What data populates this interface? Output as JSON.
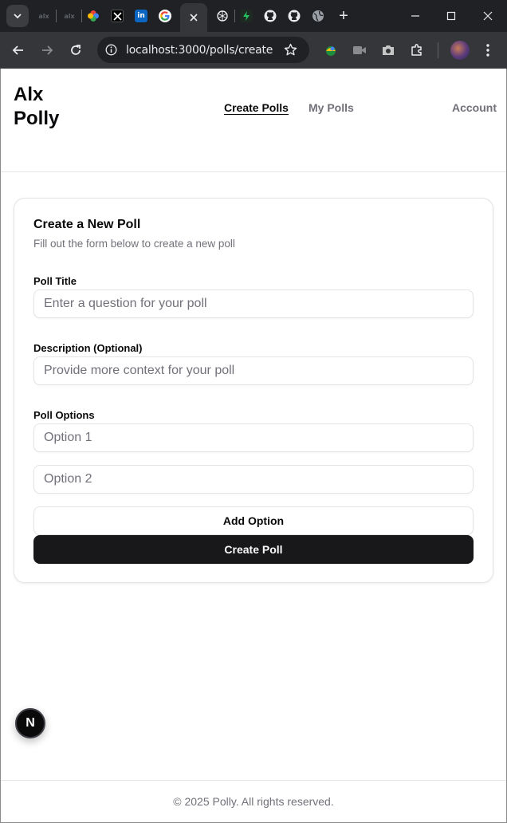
{
  "browser": {
    "url": "localhost:3000/polls/create",
    "tabs": [
      {
        "icon": "alx-icon"
      },
      {
        "icon": "alx-icon"
      },
      {
        "icon": "pinwheel-icon"
      },
      {
        "icon": "x-logo-icon"
      },
      {
        "icon": "linkedin-icon"
      },
      {
        "icon": "google-icon"
      },
      {
        "icon": "close-icon",
        "active": true
      },
      {
        "icon": "openai-icon"
      },
      {
        "icon": "bolt-icon"
      },
      {
        "icon": "github-icon"
      },
      {
        "icon": "github-icon"
      },
      {
        "icon": "globe-icon"
      }
    ],
    "new_tab_label": "+"
  },
  "header": {
    "logo": "Alx Polly",
    "nav": {
      "create": "Create Polls",
      "my_polls": "My Polls",
      "account": "Account"
    }
  },
  "form": {
    "title": "Create a New Poll",
    "description": "Fill out the form below to create a new poll",
    "poll_title_label": "Poll Title",
    "poll_title_placeholder": "Enter a question for your poll",
    "description_label": "Description (Optional)",
    "description_placeholder": "Provide more context for your poll",
    "options_label": "Poll Options",
    "option1_placeholder": "Option 1",
    "option2_placeholder": "Option 2",
    "add_option_label": "Add Option",
    "submit_label": "Create Poll"
  },
  "footer": {
    "text": "© 2025 Polly. All rights reserved."
  },
  "dev_badge": "N",
  "colors": {
    "primary": "#18181b",
    "muted": "#71717a",
    "border": "#e4e4e7",
    "chrome_dark": "#202124",
    "chrome_toolbar": "#35363a"
  }
}
